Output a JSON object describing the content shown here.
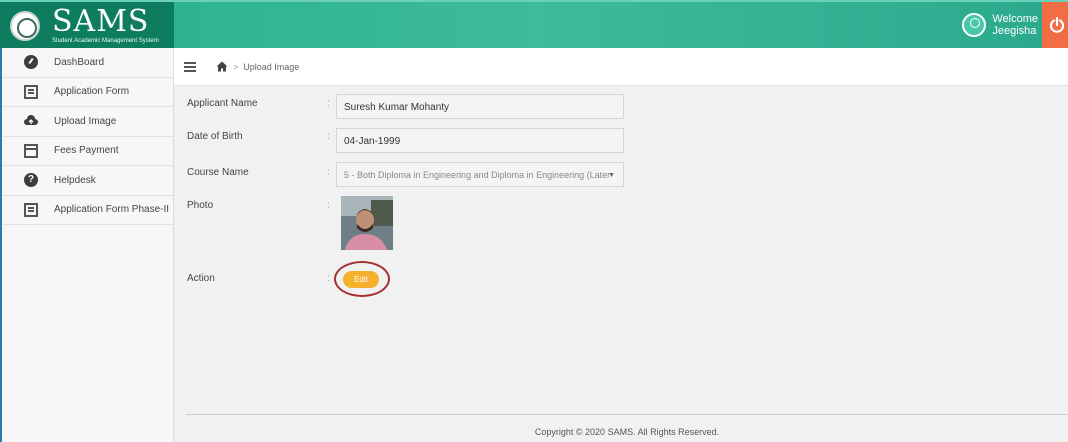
{
  "header": {
    "logo_text": "SAMS",
    "logo_subtitle": "Student Academic Management System",
    "welcome_line1": "Welcome",
    "welcome_line2": "Jeegisha",
    "colors": {
      "header_bg": "#2fb493",
      "logo_bg": "#0d7c5f",
      "power_bg": "#f26d44"
    }
  },
  "sidebar": {
    "items": [
      {
        "label": "DashBoard",
        "icon": "dashboard-icon"
      },
      {
        "label": "Application Form",
        "icon": "form-icon"
      },
      {
        "label": "Upload Image",
        "icon": "cloud-upload-icon"
      },
      {
        "label": "Fees Payment",
        "icon": "credit-card-icon"
      },
      {
        "label": "Helpdesk",
        "icon": "help-icon"
      },
      {
        "label": "Application Form Phase-II",
        "icon": "form-icon"
      }
    ]
  },
  "breadcrumb": {
    "separator": ">",
    "current": "Upload Image"
  },
  "form": {
    "applicant_name": {
      "label": "Applicant Name",
      "value": "Suresh Kumar Mohanty"
    },
    "dob": {
      "label": "Date of Birth",
      "value": "04-Jan-1999"
    },
    "course": {
      "label": "Course Name",
      "value": "5 - Both Diploma in Engineering and Diploma in Engineering (Later"
    },
    "photo": {
      "label": "Photo"
    },
    "action": {
      "label": "Action",
      "button": "Edit"
    },
    "colon": ":"
  },
  "footer": {
    "text": "Copyright © 2020 SAMS. All Rights Reserved."
  }
}
